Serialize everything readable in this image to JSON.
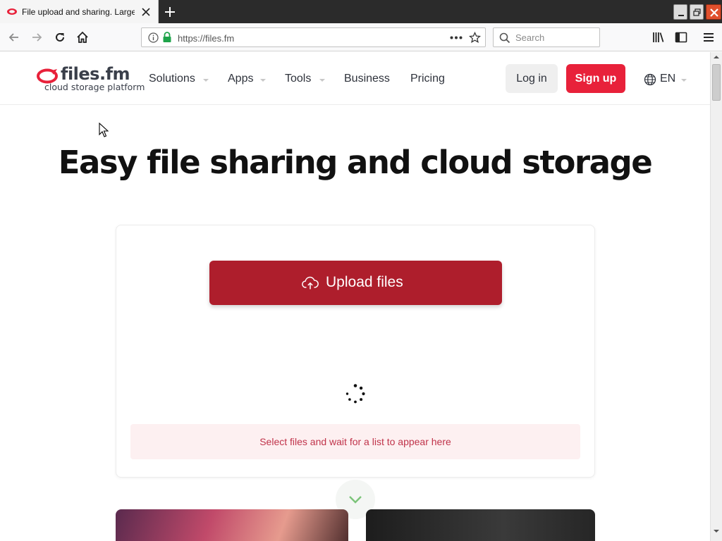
{
  "browser": {
    "tab_title": "File upload and sharing. Large file",
    "url": "https://files.fm",
    "search_placeholder": "Search"
  },
  "site": {
    "logo_name": "files.fm",
    "logo_tagline": "cloud storage platform",
    "menu": [
      {
        "label": "Solutions",
        "has_dropdown": true
      },
      {
        "label": "Apps",
        "has_dropdown": true
      },
      {
        "label": "Tools",
        "has_dropdown": true
      },
      {
        "label": "Business",
        "has_dropdown": false
      },
      {
        "label": "Pricing",
        "has_dropdown": false
      }
    ],
    "login_label": "Log in",
    "signup_label": "Sign up",
    "language": "EN"
  },
  "hero": {
    "title": "Easy file sharing and cloud storage"
  },
  "upload": {
    "button_label": "Upload files",
    "hint": "Select files and wait for a list to appear here"
  },
  "colors": {
    "brand_red": "#e8213a",
    "upload_red": "#ae1e2c",
    "hint_text": "#c0334a",
    "hint_bg": "#fdf0f1"
  },
  "icons": {
    "back": "arrow-left-icon",
    "forward": "arrow-right-icon",
    "reload": "reload-icon",
    "home": "home-icon",
    "info": "info-icon",
    "lock": "lock-icon",
    "more": "ellipsis-icon",
    "bookmark": "star-icon",
    "library": "library-icon",
    "sidebar": "sidebar-icon",
    "menu": "hamburger-icon",
    "globe": "globe-icon",
    "upload": "cloud-upload-icon"
  }
}
